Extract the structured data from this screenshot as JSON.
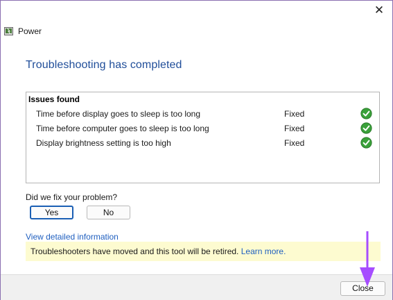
{
  "window": {
    "title": "Power",
    "close_glyph": "✕"
  },
  "main": {
    "heading": "Troubleshooting has completed",
    "issues": {
      "header": "Issues found",
      "rows": [
        {
          "text": "Time before display goes to sleep is too long",
          "status": "Fixed",
          "icon": "check-circle-icon"
        },
        {
          "text": "Time before computer goes to sleep is too long",
          "status": "Fixed",
          "icon": "check-circle-icon"
        },
        {
          "text": "Display brightness setting is too high",
          "status": "Fixed",
          "icon": "check-circle-icon"
        }
      ]
    },
    "feedback": {
      "question": "Did we fix your problem?",
      "yes_label": "Yes",
      "no_label": "No"
    },
    "detail_link": "View detailed information",
    "notice": {
      "text": "Troubleshooters have moved and this tool will be retired.",
      "link": "Learn more."
    }
  },
  "footer": {
    "close_label": "Close"
  },
  "colors": {
    "heading": "#1f4d99",
    "link": "#1f5fbf",
    "notice_bg": "#fdfbd0",
    "check_green": "#3aa13a",
    "arrow": "#a64dff"
  }
}
